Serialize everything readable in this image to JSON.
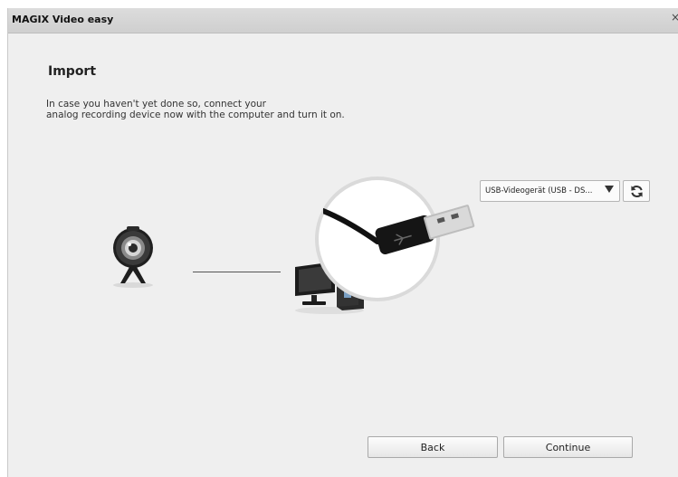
{
  "window": {
    "title": "MAGIX Video easy",
    "close_glyph": "×"
  },
  "import": {
    "heading": "Import",
    "instruction_lines": [
      "In case you haven't yet done so, connect your",
      "analog recording device now with the computer and turn it on."
    ]
  },
  "device": {
    "selected": "USB-Videogerät (USB - DS...",
    "refresh_icon": "refresh-icon"
  },
  "illustration": {
    "source_icon": "webcam-icon",
    "target_icon": "computer-icon",
    "connector_icon": "usb-plug-icon"
  },
  "buttons": {
    "back": "Back",
    "continue": "Continue"
  },
  "colors": {
    "background": "#efefef",
    "titlebar": "#d6d6d6",
    "button_border": "#a9a9a9"
  }
}
